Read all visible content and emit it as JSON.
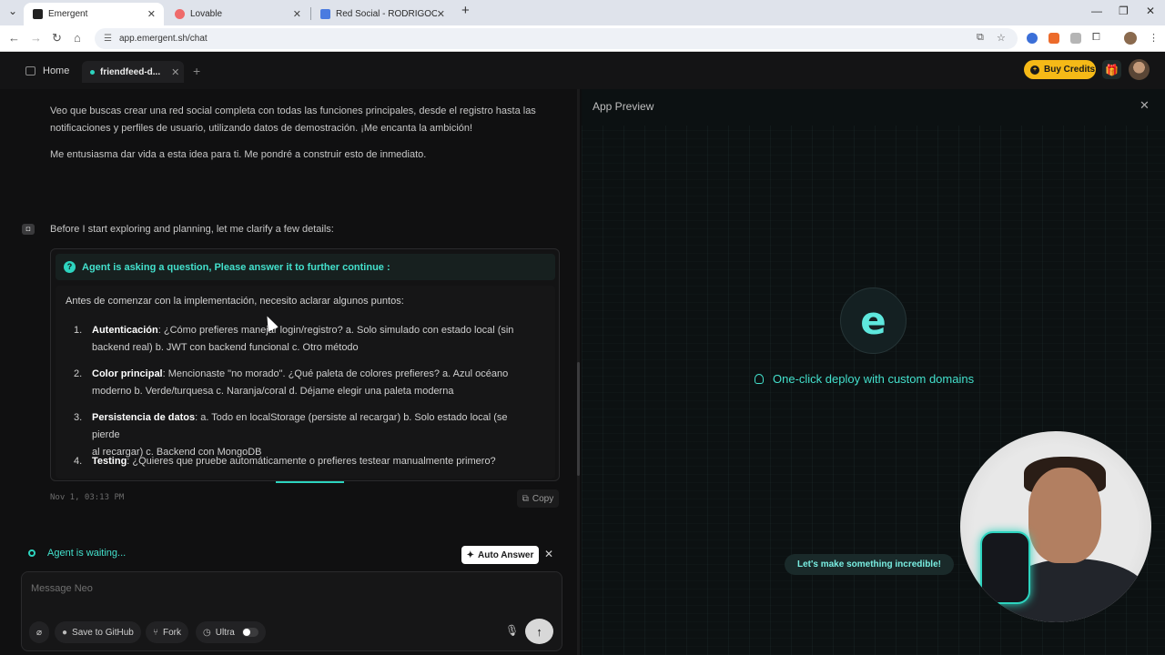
{
  "browser": {
    "tabs": [
      {
        "title": "Emergent",
        "favicon_color": "#222222"
      },
      {
        "title": "Lovable",
        "favicon_color": "#ef6a6a"
      },
      {
        "title": "Red Social - RODRIGOOLIVARES",
        "favicon_color": "#4a7be0"
      }
    ],
    "url": "app.emergent.sh/chat"
  },
  "app": {
    "home_label": "Home",
    "chat_tab_label": "friendfeed-d...",
    "buy_credits_label": "Buy Credits",
    "colors": {
      "accent": "#2dd4bf",
      "buy_credits": "#f5b917"
    }
  },
  "chat": {
    "intro_line1": "Veo que buscas crear una red social completa con todas las funciones principales, desde el registro hasta las",
    "intro_line2": "notificaciones y perfiles de usuario, utilizando datos de demostración. ¡Me encanta la ambición!",
    "intro_line3": "Me entusiasma dar vida a esta idea para ti. Me pondré a construir esto de inmediato.",
    "clarify": "Before I start exploring and planning, let me clarify a few details:",
    "question_header": "Agent is asking a question, Please answer it to further continue :",
    "question_intro": "Antes de comenzar con la implementación, necesito aclarar algunos puntos:",
    "questions": [
      {
        "num": "1.",
        "title": "Autenticación",
        "line1": ": ¿Cómo prefieres manejar login/registro? a. Solo simulado con estado local (sin",
        "line2": "backend real) b. JWT con backend funcional c. Otro método"
      },
      {
        "num": "2.",
        "title": "Color principal",
        "line1": ": Mencionaste \"no morado\". ¿Qué paleta de colores prefieres? a. Azul océano",
        "line2": "moderno b. Verde/turquesa c. Naranja/coral d. Déjame elegir una paleta moderna"
      },
      {
        "num": "3.",
        "title": "Persistencia de datos",
        "line1": ": a. Todo en localStorage (persiste al recargar) b. Solo estado local (se pierde",
        "line2": "al recargar) c. Backend con MongoDB"
      },
      {
        "num": "4.",
        "title": "Testing",
        "line1": ": ¿Quieres que pruebe automáticamente o prefieres testear manualmente primero?",
        "line2": ""
      }
    ],
    "timestamp": "Nov 1, 03:13 PM",
    "copy_label": "Copy",
    "waiting_label": "Agent is waiting...",
    "auto_answer_label": "Auto Answer",
    "message_placeholder": "Message Neo",
    "save_github_label": "Save to GitHub",
    "fork_label": "Fork",
    "ultra_label": "Ultra"
  },
  "preview": {
    "title": "App Preview",
    "logo_letter": "e",
    "deploy_text": "One-click deploy with custom domains",
    "tagline": "Let's make something incredible!"
  }
}
